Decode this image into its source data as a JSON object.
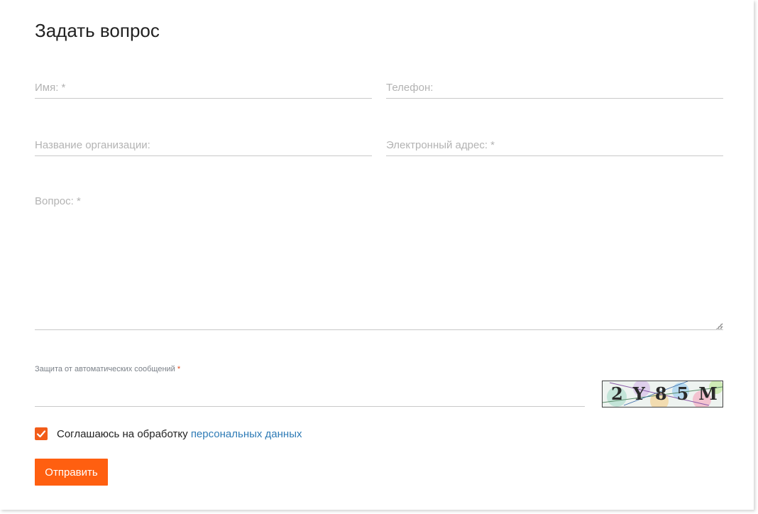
{
  "form": {
    "title": "Задать вопрос",
    "fields": {
      "name_placeholder": "Имя: *",
      "phone_placeholder": "Телефон:",
      "org_placeholder": "Название организации:",
      "email_placeholder": "Электронный адрес: *",
      "question_placeholder": "Вопрос: *"
    },
    "captcha": {
      "label": "Защита от автоматических сообщений",
      "required_mark": "*",
      "input_value": "",
      "image_text": "2Y85M"
    },
    "consent": {
      "checked": true,
      "text": "Соглашаюсь на обработку ",
      "link_text": "персональных данных"
    },
    "submit_label": "Отправить"
  },
  "colors": {
    "accent": "#ff5f10",
    "link": "#2e7bb6"
  }
}
